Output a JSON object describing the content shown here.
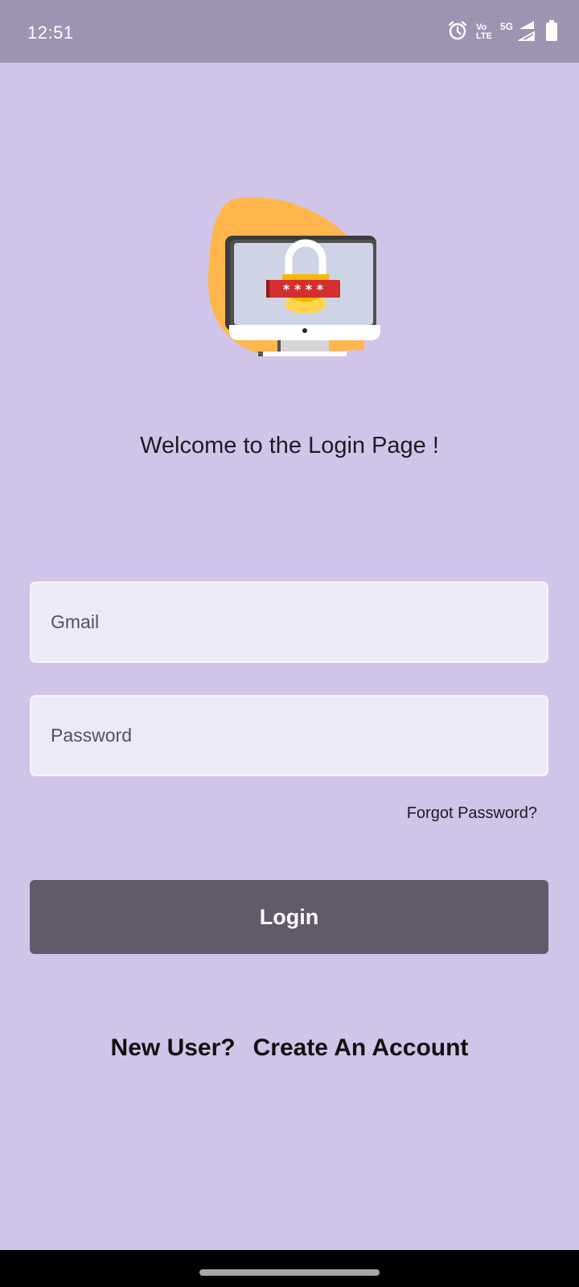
{
  "status_bar": {
    "time": "12:51",
    "volte_top": "Vo",
    "volte_bottom": "LTE",
    "network": "5G",
    "icons": [
      "alarm-icon",
      "volte-icon",
      "signal-icon",
      "signal-icon",
      "battery-icon"
    ]
  },
  "hero": {
    "icon": "monitor-padlock-illustration",
    "colors": {
      "blob": "#ffb74d",
      "screen": "#cfd3e6",
      "lock": "#f5b800",
      "password_bar": "#d32f2f"
    }
  },
  "welcome_text": "Welcome to the Login Page !",
  "form": {
    "email_placeholder": "Gmail",
    "email_value": "",
    "password_placeholder": "Password",
    "password_value": "",
    "forgot_password": "Forgot Password?",
    "login_label": "Login"
  },
  "signup": {
    "prompt": "New User?",
    "link": "Create An Account"
  },
  "colors": {
    "background": "#d0c4e8",
    "status_bar": "#9c94b0",
    "field_background": "#edeaf8",
    "button": "#615a6b"
  }
}
